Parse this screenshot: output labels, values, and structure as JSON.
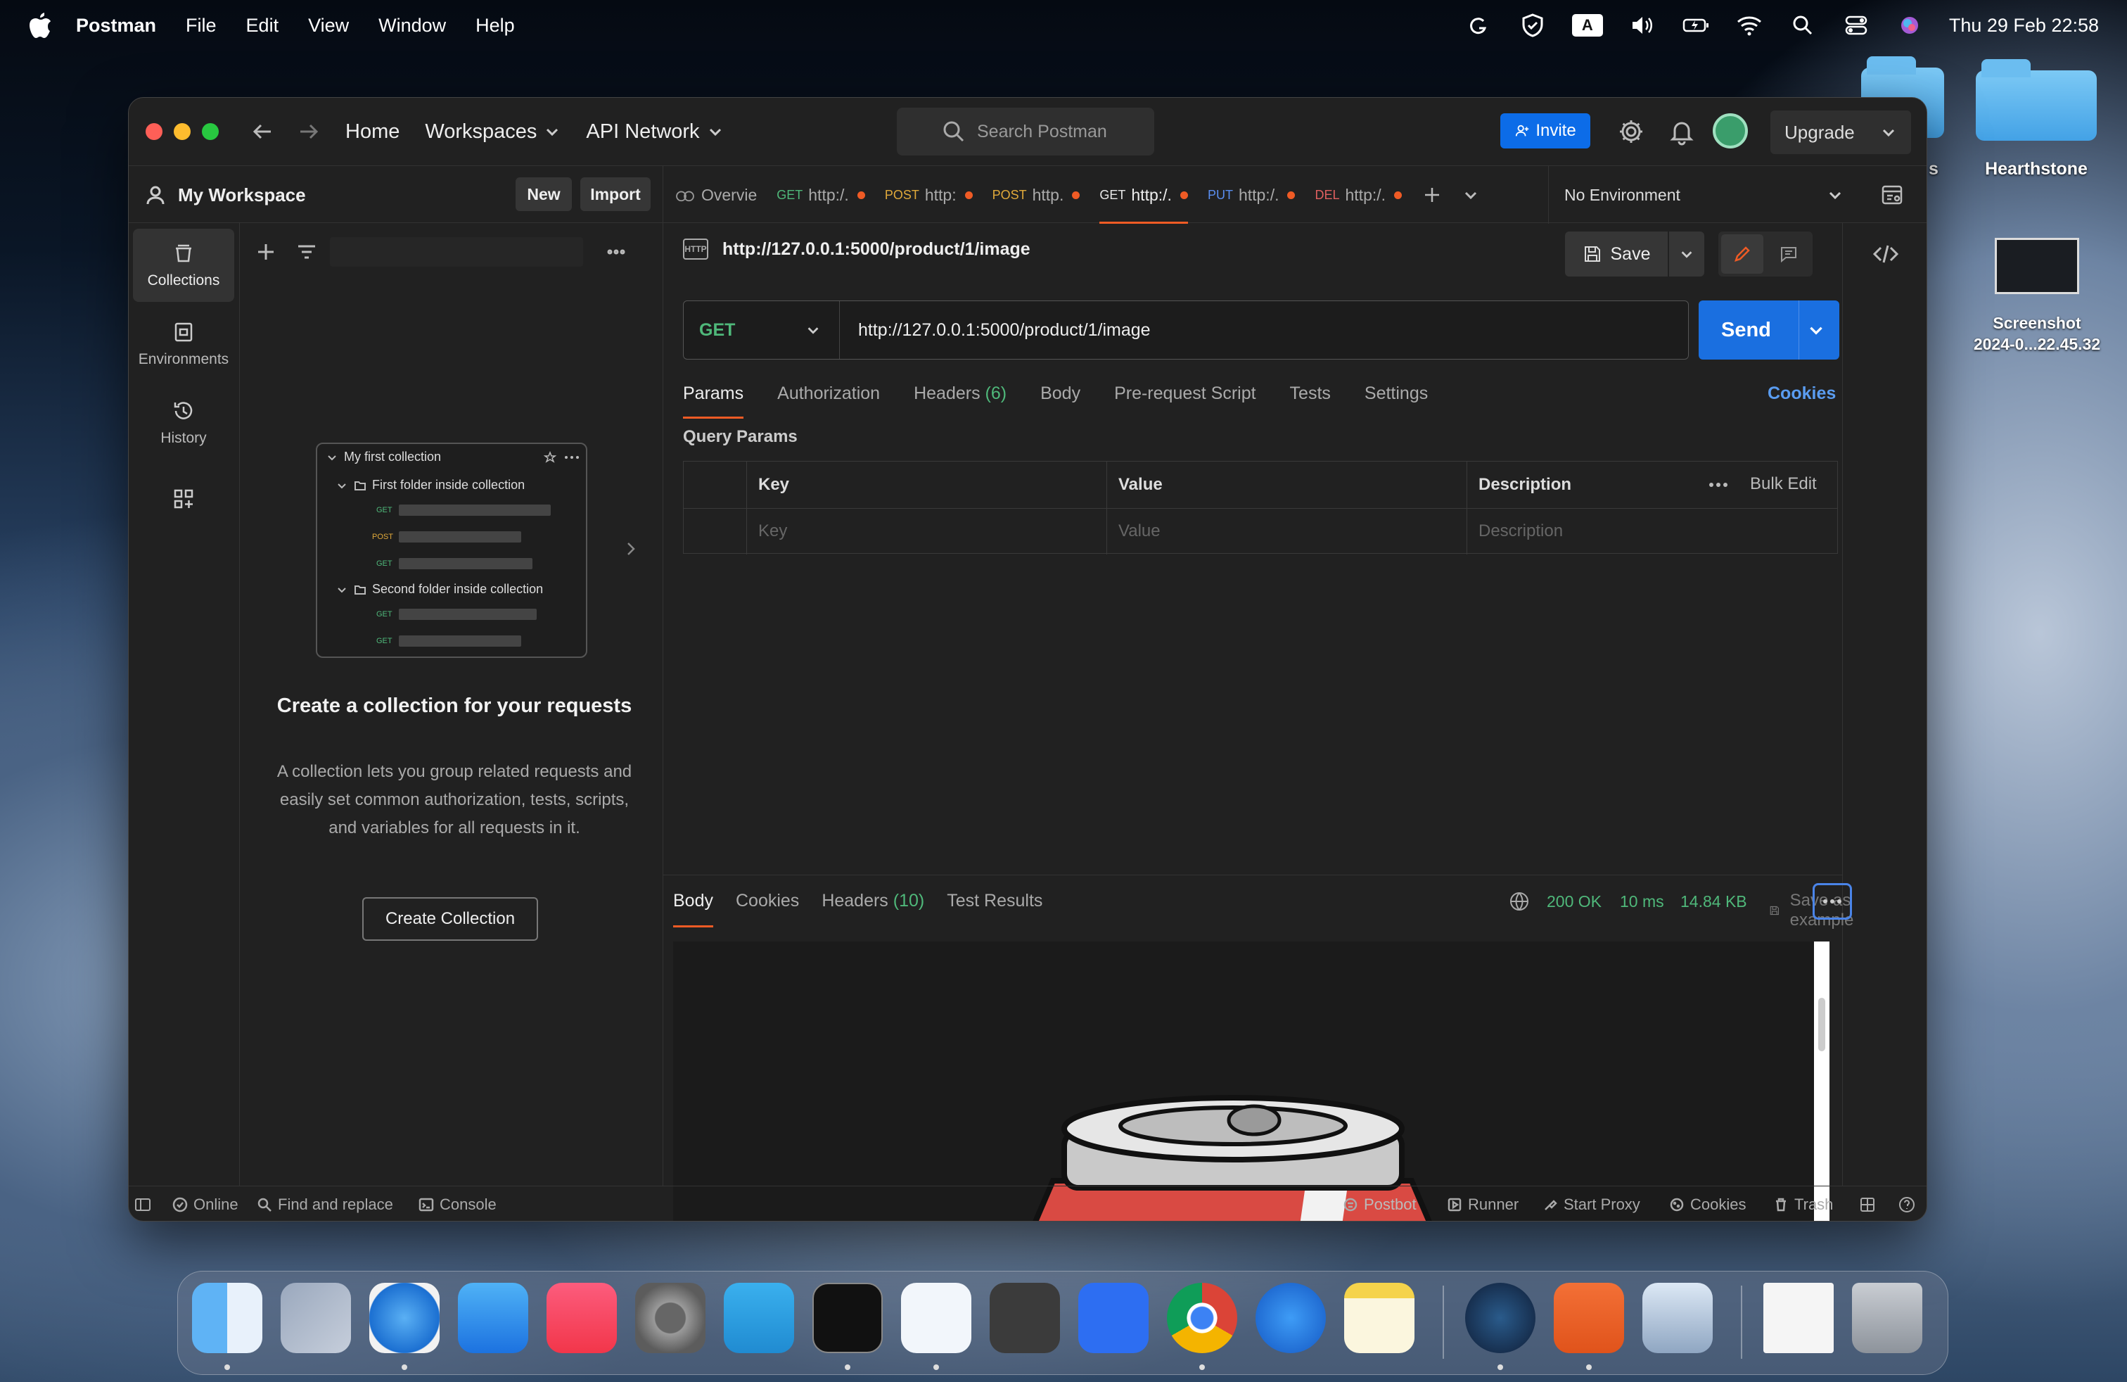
{
  "menubar": {
    "app": "Postman",
    "items": [
      "File",
      "Edit",
      "View",
      "Window",
      "Help"
    ],
    "clock": "Thu 29 Feb  22:58",
    "kbd": "A"
  },
  "desktop": {
    "icons": [
      {
        "label": "s"
      },
      {
        "label": "Hearthstone"
      },
      {
        "label": "Screenshot\n2024-0...22.45.32"
      }
    ]
  },
  "titlebar": {
    "home": "Home",
    "workspaces": "Workspaces",
    "api_network": "API Network",
    "search_placeholder": "Search Postman",
    "invite": "Invite",
    "upgrade": "Upgrade"
  },
  "workspace": {
    "name": "My Workspace",
    "new": "New",
    "import": "Import"
  },
  "tabs": [
    {
      "method": "",
      "label": "Overvie",
      "method_color": "#aaa"
    },
    {
      "method": "GET",
      "label": "http:/.",
      "method_color": "#4fb87a"
    },
    {
      "method": "POST",
      "label": "http:",
      "method_color": "#e0a93a"
    },
    {
      "method": "POST",
      "label": "http.",
      "method_color": "#e0a93a"
    },
    {
      "method": "GET",
      "label": "http:/.",
      "method_color": "#4fb87a"
    },
    {
      "method": "PUT",
      "label": "http:/.",
      "method_color": "#5a8ef0"
    },
    {
      "method": "DEL",
      "label": "http:/.",
      "method_color": "#e06060"
    }
  ],
  "environment": "No Environment",
  "rail": {
    "collections": "Collections",
    "environments": "Environments",
    "history": "History"
  },
  "sidebar": {
    "illustration": {
      "collection": "My first collection",
      "folder1": "First folder inside collection",
      "folder2": "Second folder inside collection",
      "methods": [
        "GET",
        "POST",
        "GET",
        "GET",
        "GET"
      ]
    },
    "title": "Create a collection for your requests",
    "description": "A collection lets you group related requests and easily set common authorization, tests, scripts, and variables for all requests in it.",
    "create_button": "Create Collection"
  },
  "request": {
    "name": "http://127.0.0.1:5000/product/1/image",
    "http_badge": "HTTP",
    "save": "Save",
    "method": "GET",
    "url": "http://127.0.0.1:5000/product/1/image",
    "send": "Send",
    "tabs": {
      "params": "Params",
      "authorization": "Authorization",
      "headers": "Headers",
      "headers_count": "(6)",
      "body": "Body",
      "prerequest": "Pre-request Script",
      "tests": "Tests",
      "settings": "Settings"
    },
    "cookies": "Cookies",
    "query_params_label": "Query Params",
    "table": {
      "key": "Key",
      "value": "Value",
      "description": "Description",
      "bulk_edit": "Bulk Edit",
      "key_ph": "Key",
      "value_ph": "Value",
      "desc_ph": "Description"
    }
  },
  "response": {
    "tabs": {
      "body": "Body",
      "cookies": "Cookies",
      "headers": "Headers",
      "headers_count": "(10)",
      "test_results": "Test Results"
    },
    "status": "200 OK",
    "time": "10 ms",
    "size": "14.84 KB",
    "save_example": "Save as example"
  },
  "statusbar": {
    "online": "Online",
    "find_replace": "Find and replace",
    "console": "Console",
    "postbot": "Postbot",
    "runner": "Runner",
    "start_proxy": "Start Proxy",
    "cookies": "Cookies",
    "trash": "Trash"
  },
  "dock": [
    "Finder",
    "Launchpad",
    "Safari",
    "Mail",
    "Music",
    "System Settings",
    "Telegram",
    "Terminal",
    "Visual Studio Code",
    "Sublime Text",
    "Zoom",
    "Chrome",
    "Xcode",
    "Notes",
    "Steam",
    "Postman",
    "Preview",
    "Document",
    "Trash"
  ],
  "colors": {
    "accent": "#ef5b25",
    "send": "#1a6fe0",
    "ok": "#4fb87a"
  }
}
